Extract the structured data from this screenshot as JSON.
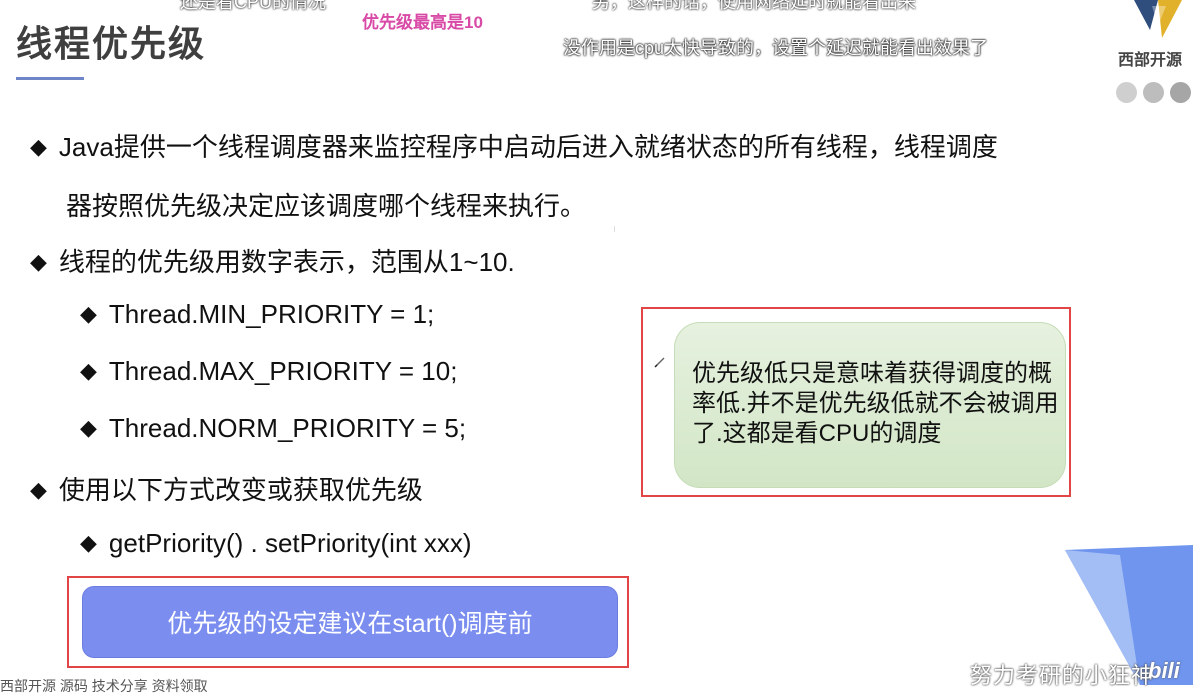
{
  "danmaku": {
    "top_left_cut": "还是看CPU的情况",
    "top_right_cut": "另，这样的话，使用网络延时就能看出来",
    "pink": "优先级最高是10",
    "white": "没作用是cpu太快导致的，设置个延迟就能看出效果了"
  },
  "slide": {
    "title": "线程优先级",
    "bullets": {
      "b1_line1": "Java提供一个线程调度器来监控程序中启动后进入就绪状态的所有线程，线程调度",
      "b1_line2": "器按照优先级决定应该调度哪个线程来执行。",
      "b2": "线程的优先级用数字表示，范围从1~10.",
      "s1": "Thread.MIN_PRIORITY = 1;",
      "s2": "Thread.MAX_PRIORITY = 10;",
      "s3": "Thread.NORM_PRIORITY = 5;",
      "b3": "使用以下方式改变或获取优先级",
      "s4": "getPriority() . setPriority(int xxx)"
    },
    "note": "优先级低只是意味着获得调度的概率低.并不是优先级低就不会被调用了.这都是看CPU的调度",
    "advice_button": "优先级的设定建议在start()调度前"
  },
  "logo": {
    "text": "西部开源"
  },
  "watermark": {
    "text": "努力考研的小狂神",
    "site": "bili"
  },
  "footer_cut": "西部开源  源码  技术分享  资料领取",
  "colors": {
    "title": "#3f3f3f",
    "accent_line": "#6e86c8",
    "highlight_frame": "#e24545",
    "note_bg": "#d8ead0",
    "button_bg": "#7b8ef0",
    "danmaku_pink": "#d84aa6"
  }
}
